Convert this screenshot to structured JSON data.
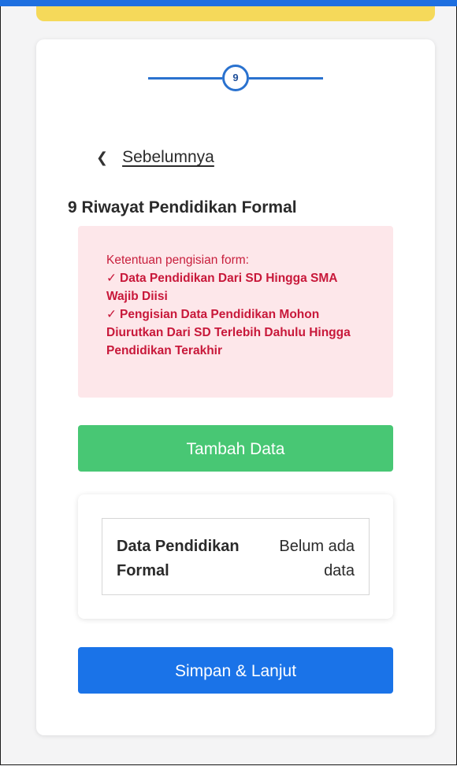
{
  "stepper": {
    "current_step": "9"
  },
  "nav": {
    "back_label": "Sebelumnya"
  },
  "section": {
    "title": "9 Riwayat Pendidikan Formal"
  },
  "notice": {
    "heading": "Ketentuan pengisian form:",
    "rules": [
      "Data Pendidikan Dari SD Hingga SMA Wajib Diisi",
      "Pengisian Data Pendidikan Mohon Diurutkan Dari SD Terlebih Dahulu Hingga Pendidikan Terakhir"
    ]
  },
  "actions": {
    "add_label": "Tambah Data",
    "save_label": "Simpan & Lanjut"
  },
  "data_table": {
    "key": "Data Pendidikan Formal",
    "value": "Belum ada data"
  },
  "colors": {
    "primary": "#1a73e8",
    "success": "#48c774",
    "notice_bg": "#fde7ea",
    "notice_text": "#c8183a",
    "accent_yellow": "#f5d95a"
  }
}
